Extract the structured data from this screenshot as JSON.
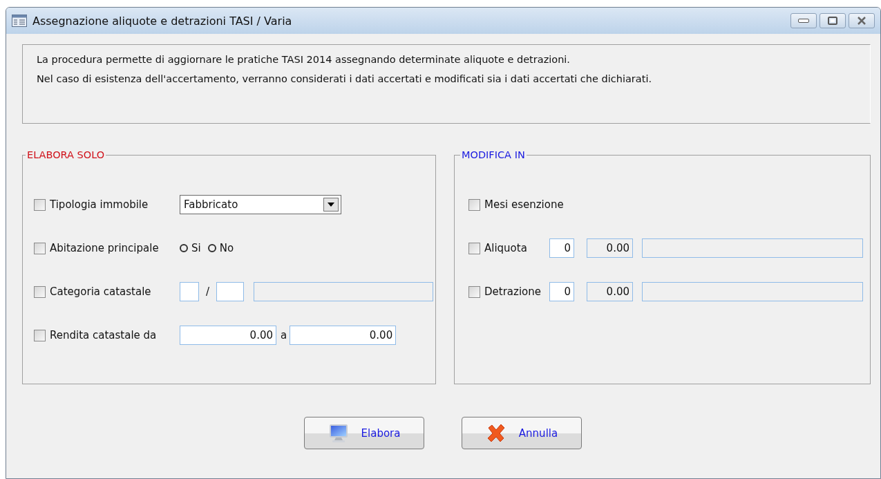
{
  "window": {
    "title": "Assegnazione aliquote e detrazioni TASI / Varia"
  },
  "info": [
    "La procedura permette di aggiornare le pratiche TASI 2014 assegnando determinate aliquote e detrazioni.",
    "Nel caso di esistenza dell'accertamento, verranno considerati i dati accertati e modificati sia i dati accertati che dichiarati."
  ],
  "elabora_solo": {
    "title": "ELABORA SOLO",
    "rows": [
      {
        "kind": "combo",
        "label": "Tipologia immobile",
        "checked": false,
        "value": "Fabbricato"
      },
      {
        "kind": "radio",
        "label": "Abitazione principale",
        "checked": false,
        "options": [
          {
            "label": "Si",
            "selected": false
          },
          {
            "label": "No",
            "selected": false
          }
        ]
      },
      {
        "kind": "category",
        "label": "Categoria catastale",
        "checked": false,
        "separator": "/"
      },
      {
        "kind": "range",
        "label": "Rendita catastale da",
        "checked": false,
        "from": "0.00",
        "joiner": "a",
        "to": "0.00"
      }
    ]
  },
  "modifica_in": {
    "title": "MODIFICA IN",
    "rows": [
      {
        "kind": "plain",
        "label": "Mesi esenzione",
        "checked": false
      },
      {
        "kind": "code",
        "label": "Aliquota",
        "checked": false,
        "code": "0",
        "amount": "0.00"
      },
      {
        "kind": "code",
        "label": "Detrazione",
        "checked": false,
        "code": "0",
        "amount": "0.00"
      }
    ]
  },
  "buttons": [
    {
      "kind": "run",
      "label": "Elabora"
    },
    {
      "kind": "cancel",
      "label": "Annulla"
    }
  ]
}
